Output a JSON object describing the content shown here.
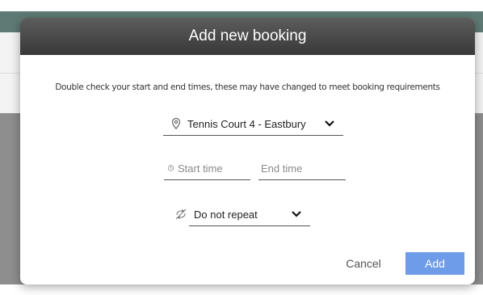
{
  "dialog": {
    "title": "Add new booking",
    "notice": "Double check your start and end times, these may have changed to meet booking requirements"
  },
  "location": {
    "selected": "Tennis Court 4 - Eastbury",
    "icon": "location-pin-icon"
  },
  "times": {
    "start_placeholder": "Start time",
    "end_placeholder": "End time",
    "icon": "clock-icon"
  },
  "repeat": {
    "selected": "Do not repeat",
    "icon": "repeat-icon"
  },
  "buttons": {
    "cancel_label": "Cancel",
    "add_label": "Add"
  },
  "colors": {
    "header": "#474747",
    "add_button": "#6e9ce8",
    "backdrop": "#8e8e8e"
  }
}
